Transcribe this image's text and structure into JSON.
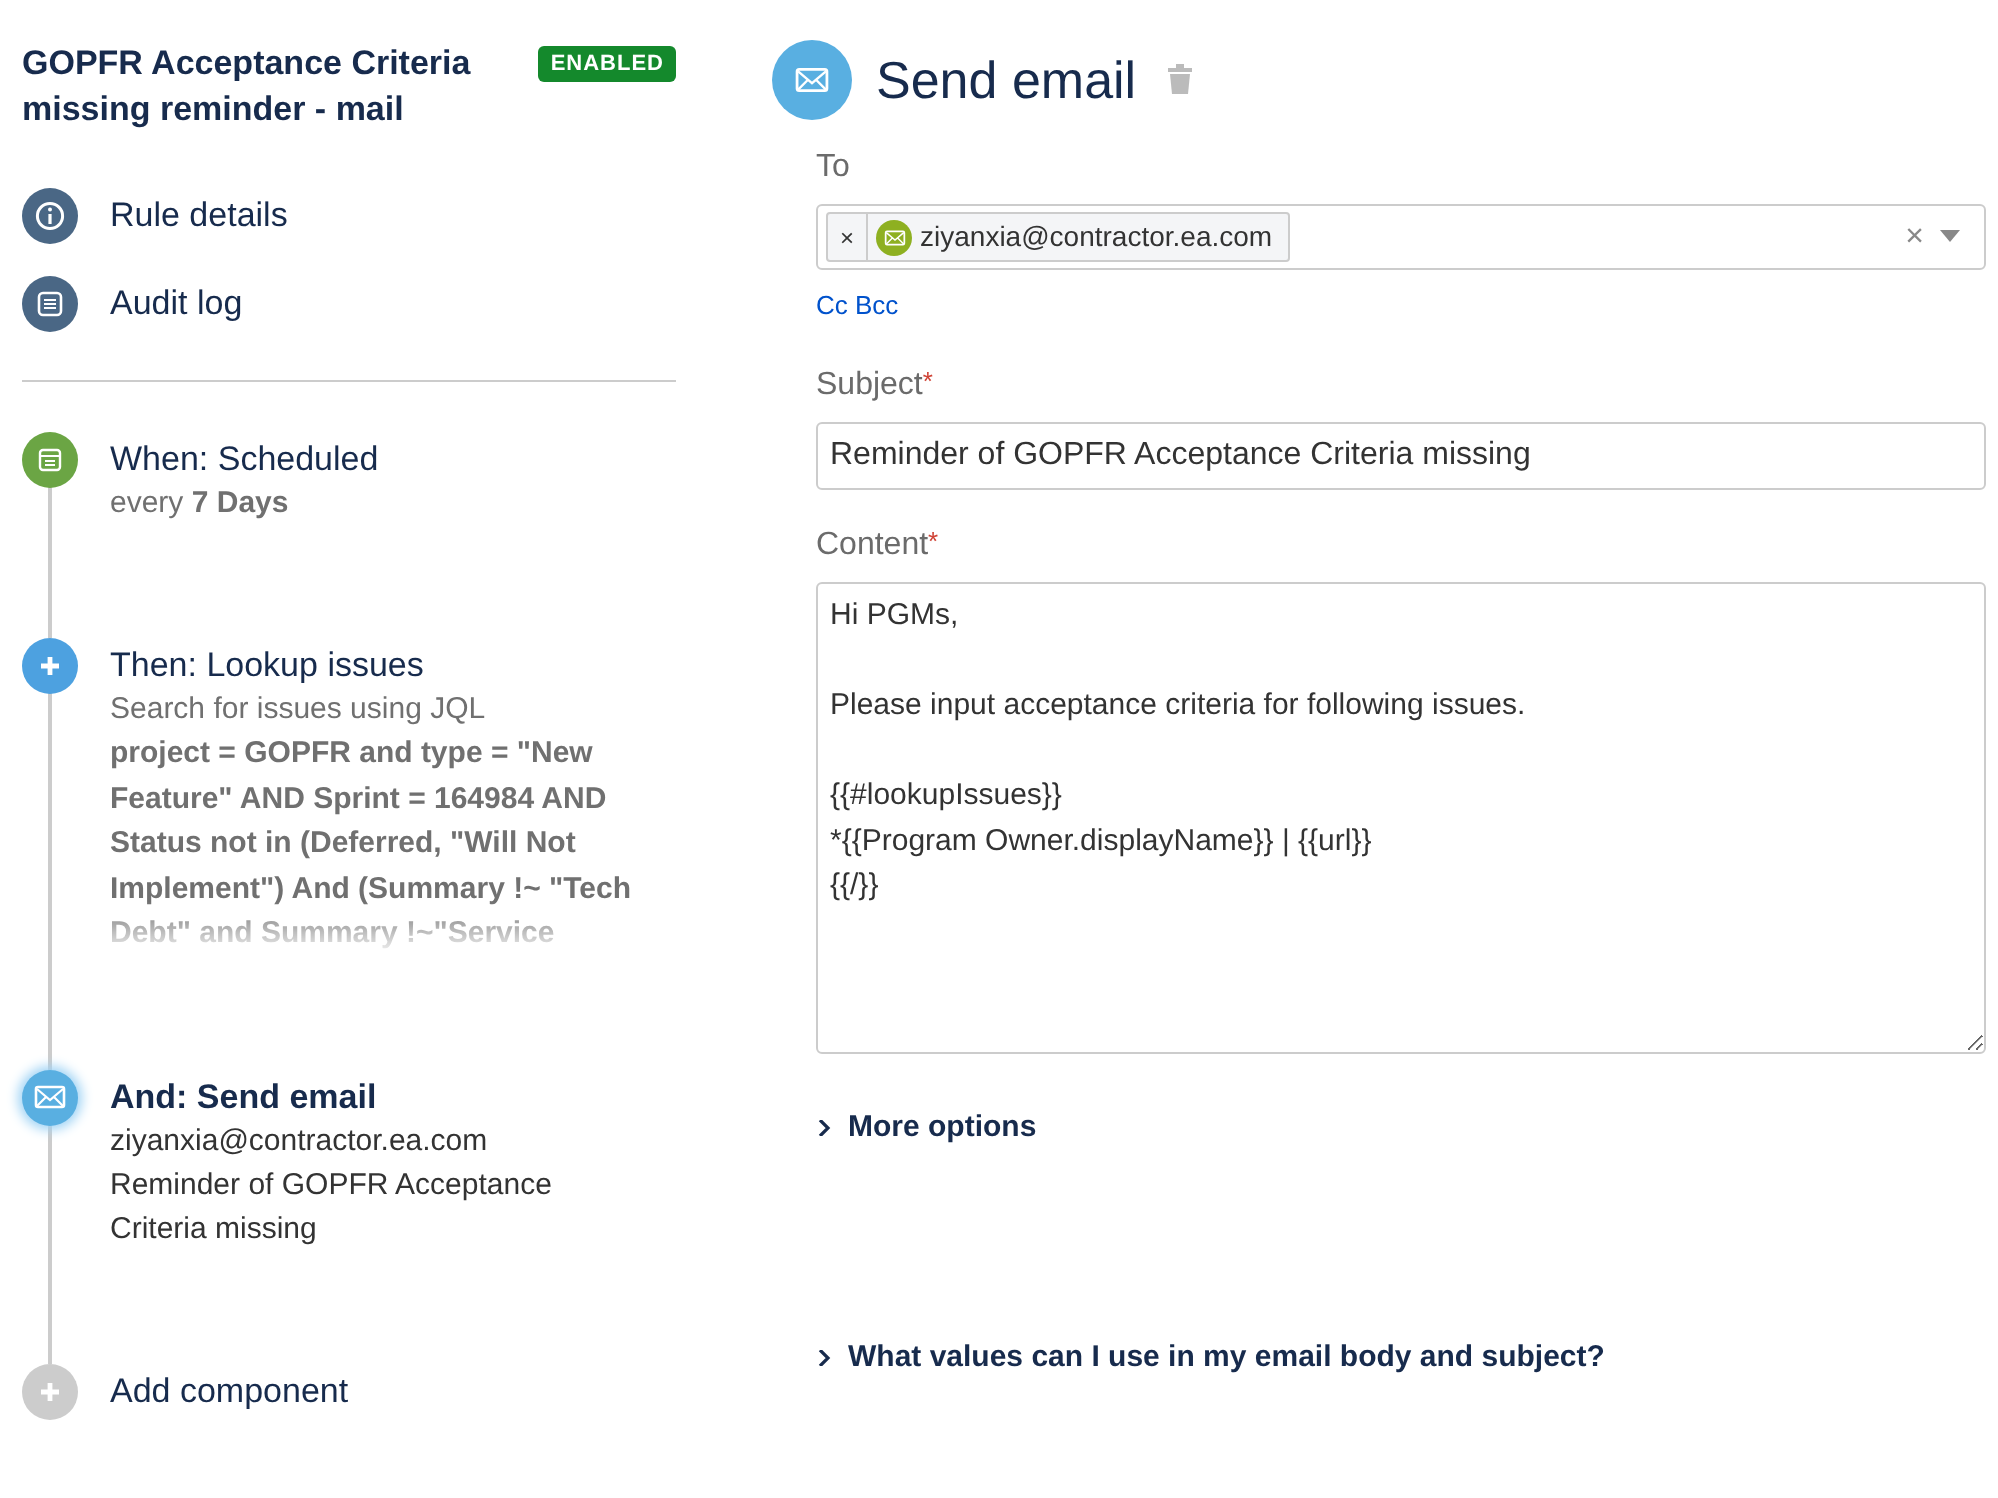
{
  "rule": {
    "title": "GOPFR Acceptance Criteria missing reminder - mail",
    "status": {
      "label": "ENABLED",
      "kind": "enabled"
    }
  },
  "nav": [
    {
      "label": "Rule details",
      "kind": "info"
    },
    {
      "label": "Audit log",
      "kind": "log"
    }
  ],
  "steps": [
    {
      "kind": "trigger",
      "title": "When: Scheduled",
      "selected": false,
      "lines": [
        "every **7 Days**"
      ]
    },
    {
      "kind": "action",
      "title": "Then: Lookup issues",
      "selected": false,
      "lines": [
        "Search for issues using JQL"
      ],
      "query": "project = GOPFR and type = \"New Feature\" AND Sprint = 164984 AND Status not in (Deferred, \"Will Not Implement\") And (Summary !~ \"Tech Debt\" and Summary !~\"Service"
    },
    {
      "kind": "email",
      "title": "And: Send email",
      "selected": true,
      "lines": [
        "ziyanxia@contractor.ea.com",
        "Reminder of GOPFR Acceptance Criteria missing"
      ]
    },
    {
      "kind": "add",
      "title": "Add component",
      "selected": false
    }
  ],
  "panel": {
    "title": "Send email",
    "to": {
      "label": "To",
      "recipients": [
        "ziyanxia@contractor.ea.com"
      ],
      "remove": "×",
      "clear": "×"
    },
    "cc_link": "Cc Bcc",
    "subject": {
      "label": "Subject",
      "required_mark": "*",
      "value": "Reminder of GOPFR Acceptance Criteria missing"
    },
    "content": {
      "label": "Content",
      "required_mark": "*",
      "value": "Hi PGMs,\n\nPlease input acceptance criteria for following issues.\n\n{{#lookupIssues}}\n*{{Program Owner.displayName}} | {{url}}\n{{/}}"
    },
    "expanders": [
      {
        "label": "More options",
        "expanded": false
      },
      {
        "label": "What values can I use in my email body and subject?",
        "expanded": false
      }
    ]
  }
}
